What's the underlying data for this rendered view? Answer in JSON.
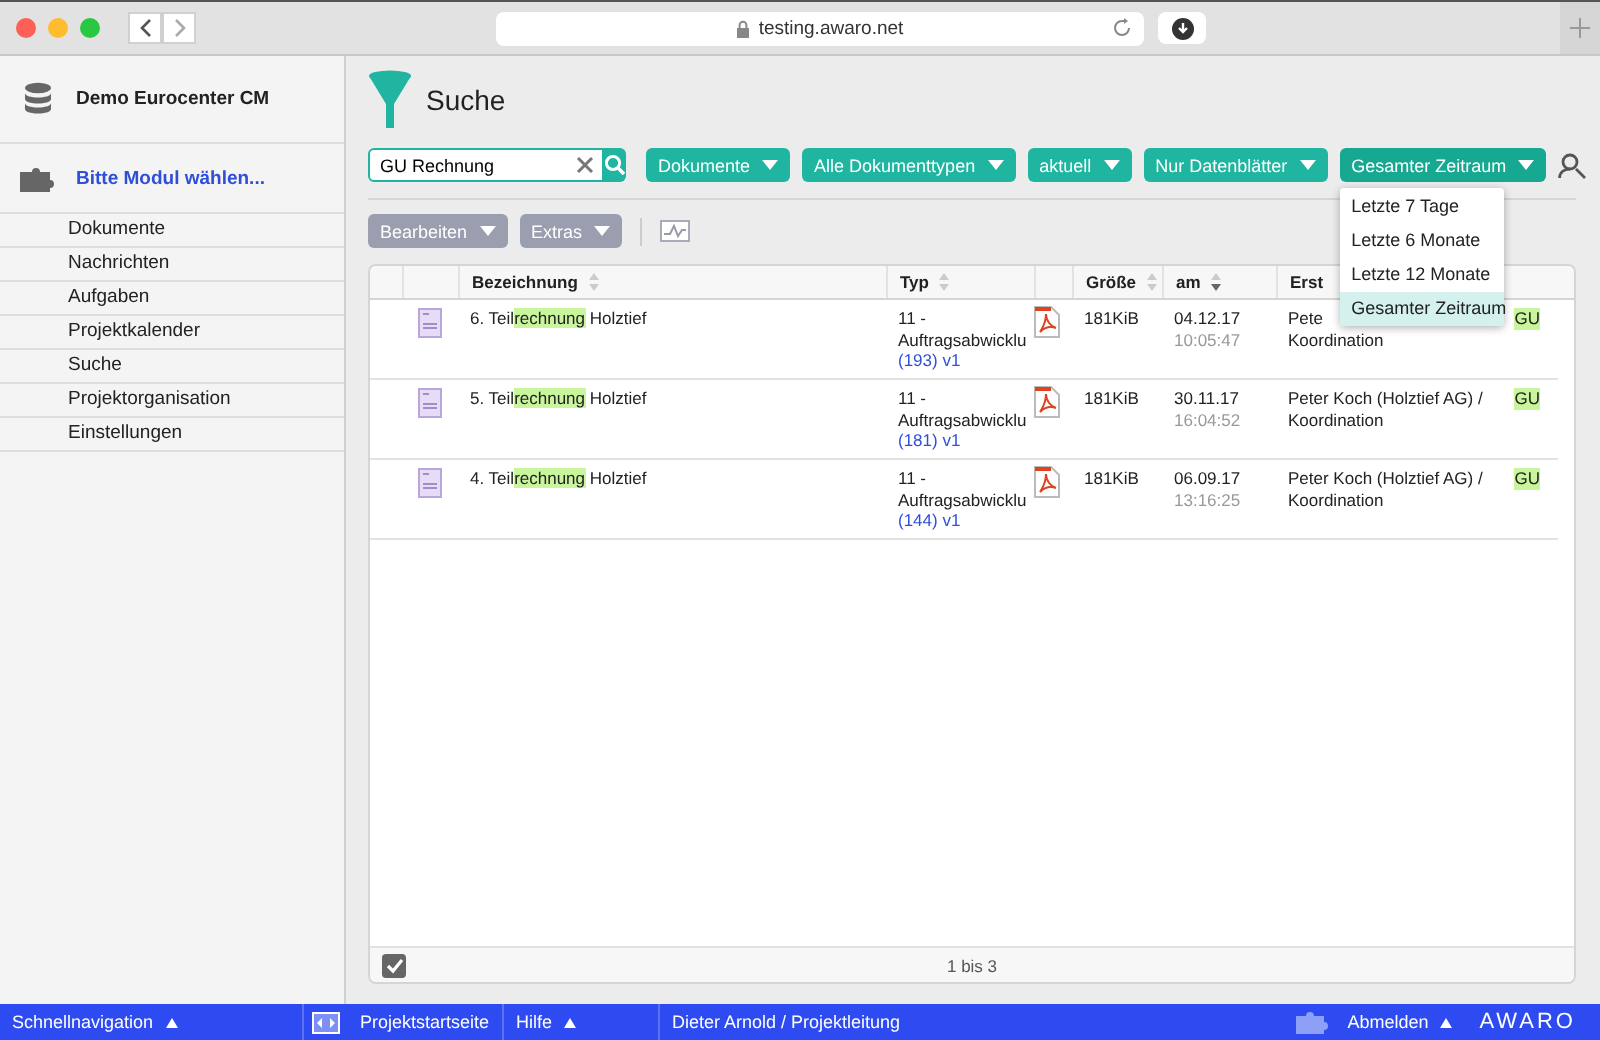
{
  "browser": {
    "url": "testing.awaro.net"
  },
  "sidebar": {
    "project": "Demo Eurocenter CM",
    "module": "Bitte Modul wählen...",
    "items": [
      {
        "label": "Dokumente"
      },
      {
        "label": "Nachrichten"
      },
      {
        "label": "Aufgaben"
      },
      {
        "label": "Projektkalender"
      },
      {
        "label": "Suche"
      },
      {
        "label": "Projektorganisation"
      },
      {
        "label": "Einstellungen"
      }
    ]
  },
  "page": {
    "title": "Suche"
  },
  "search": {
    "value": "GU Rechnung"
  },
  "filters": [
    {
      "label": "Dokumente",
      "open": false
    },
    {
      "label": "Alle Dokumenttypen",
      "open": false
    },
    {
      "label": "aktuell",
      "open": false
    },
    {
      "label": "Nur Datenblätter",
      "open": false
    },
    {
      "label": "Gesamter Zeitraum",
      "open": true
    }
  ],
  "filter_menu": {
    "items": [
      {
        "label": "Letzte 7 Tage",
        "selected": false
      },
      {
        "label": "Letzte 6 Monate",
        "selected": false
      },
      {
        "label": "Letzte 12 Monate",
        "selected": false
      },
      {
        "label": "Gesamter Zeitraum",
        "selected": true
      }
    ]
  },
  "toolbar": {
    "buttons": [
      "Bearbeiten",
      "Extras"
    ]
  },
  "table": {
    "columns": [
      {
        "label": "Bezeichnung",
        "sortable": true,
        "sort_desc": false
      },
      {
        "label": "Typ",
        "sortable": true,
        "sort_desc": false
      },
      {
        "label": "Größe",
        "sortable": true,
        "sort_desc": false
      },
      {
        "label": "am",
        "sortable": true,
        "sort_desc": true
      },
      {
        "label": "Erst",
        "sortable": false
      }
    ],
    "rows": [
      {
        "title": [
          {
            "text": "6. Teil",
            "highlight": false
          },
          {
            "text": "rechnung",
            "highlight": true
          },
          {
            "text": " Holztief",
            "highlight": false
          }
        ],
        "type": "11 -",
        "type_2": "Auftragsabwicklu",
        "version": "(193) v1",
        "size": "181KiB",
        "date": "04.12.17",
        "time": "10:05:47",
        "creator": [
          {
            "text": "Pete",
            "highlight": false
          },
          {
            "text": "GU",
            "highlight": true
          }
        ],
        "creator_2": "Koordination"
      },
      {
        "title": [
          {
            "text": "5. Teil",
            "highlight": false
          },
          {
            "text": "rechnung",
            "highlight": true
          },
          {
            "text": " Holztief",
            "highlight": false
          }
        ],
        "type": "11 -",
        "type_2": "Auftragsabwicklu",
        "version": "(181) v1",
        "size": "181KiB",
        "date": "30.11.17",
        "time": "16:04:52",
        "creator": [
          {
            "text": "Peter Koch (Holztief AG) / ",
            "highlight": false
          },
          {
            "text": "GU",
            "highlight": true
          }
        ],
        "creator_2": "Koordination"
      },
      {
        "title": [
          {
            "text": "4. Teil",
            "highlight": false
          },
          {
            "text": "rechnung",
            "highlight": true
          },
          {
            "text": " Holztief",
            "highlight": false
          }
        ],
        "type": "11 -",
        "type_2": "Auftragsabwicklu",
        "version": "(144) v1",
        "size": "181KiB",
        "date": "06.09.17",
        "time": "13:16:25",
        "creator": [
          {
            "text": "Peter Koch (Holztief AG) / ",
            "highlight": false
          },
          {
            "text": "GU",
            "highlight": true
          }
        ],
        "creator_2": "Koordination"
      }
    ],
    "footer": "1 bis 3"
  },
  "status_bar": {
    "quick_nav": "Schnellnavigation",
    "home": "Projektstartseite",
    "help": "Hilfe",
    "user": "Dieter Arnold / Projektleitung",
    "logout": "Abmelden",
    "logo": "AWARO"
  }
}
